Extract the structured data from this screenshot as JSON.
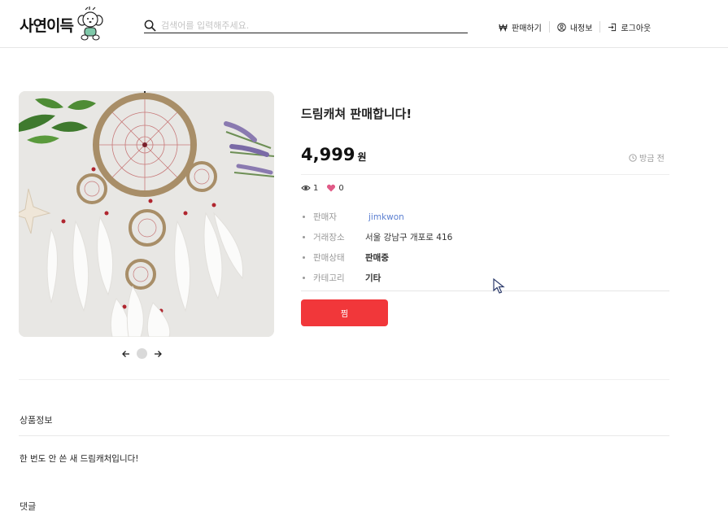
{
  "header": {
    "logo_text": "사연이득",
    "search_placeholder": "검색어를 입력해주세요.",
    "nav": {
      "sell_label": "판매하기",
      "myinfo_label": "내정보",
      "logout_label": "로그아웃"
    }
  },
  "product": {
    "title": "드림캐쳐 판매합니다!",
    "price": "4,999",
    "price_unit": "원",
    "time": "방금 전",
    "views": "1",
    "likes": "0",
    "info": {
      "seller_label": "판매자",
      "seller_value": "jimkwon",
      "location_label": "거래장소",
      "location_value": "서울 강남구 개포로 416",
      "status_label": "판매상태",
      "status_value": "판매중",
      "category_label": "카테고리",
      "category_value": "기타"
    },
    "like_button_label": "찜",
    "image_count": 1,
    "current_image": 1
  },
  "details": {
    "section_title": "상품정보",
    "description": "한 번도 안 쓴 새 드림캐처입니다!",
    "comments_title": "댓글"
  },
  "colors": {
    "accent": "#f1373a",
    "heart": "#e05a87",
    "seller_link": "#5b7fd1"
  },
  "icons": {
    "search": "search-icon",
    "sell": "won-icon",
    "myinfo": "user-circle-icon",
    "logout": "logout-icon",
    "time": "clock-icon",
    "views": "eye-icon",
    "likes": "heart-icon",
    "prev": "arrow-left-icon",
    "next": "arrow-right-icon"
  }
}
